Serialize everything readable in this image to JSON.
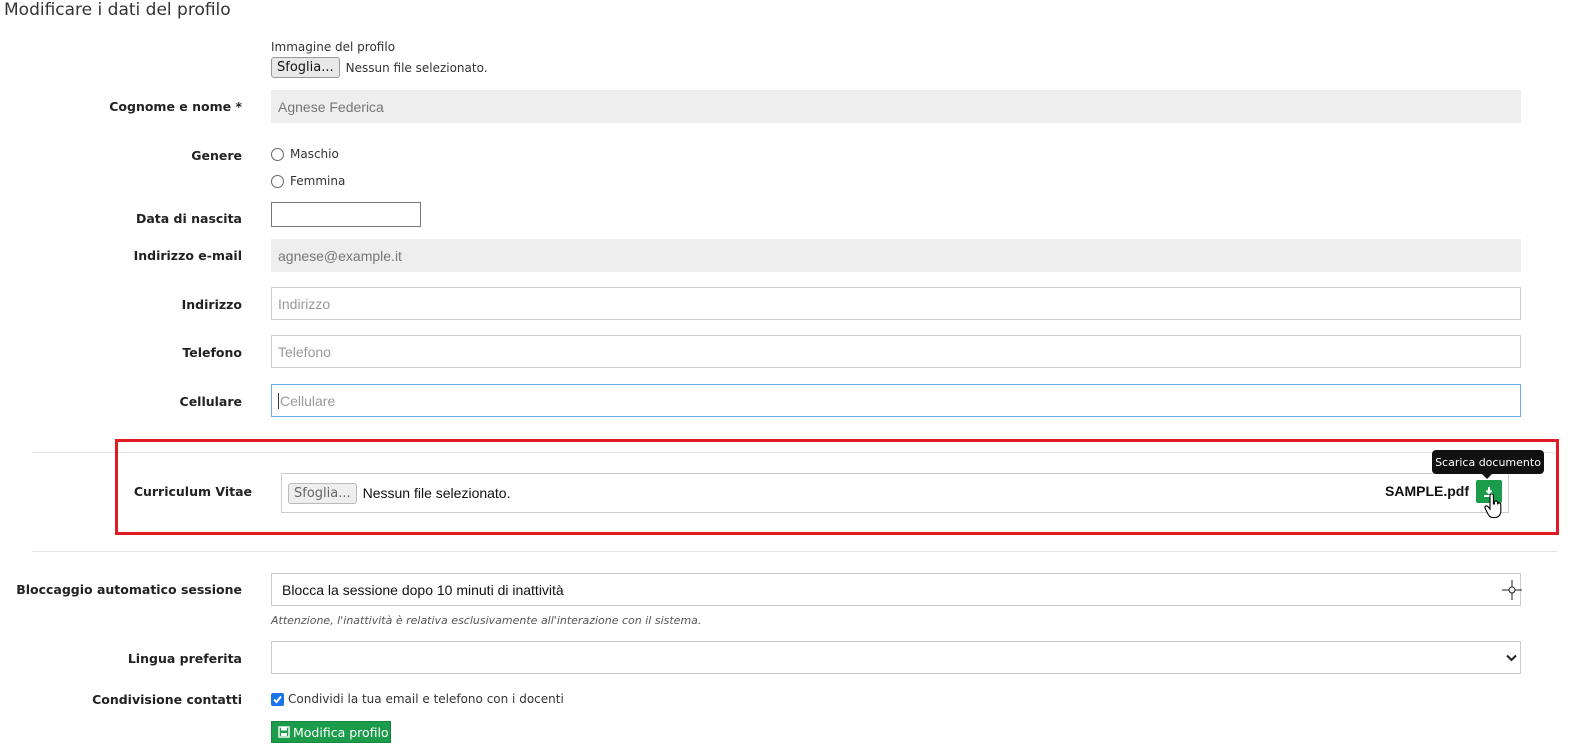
{
  "page_title": "Modificare i dati del profilo",
  "profile_image": {
    "label": "Immagine del profilo",
    "browse_label": "Sfoglia...",
    "status": "Nessun file selezionato."
  },
  "fields": {
    "name": {
      "label": "Cognome e nome *",
      "value": "Agnese Federica"
    },
    "gender": {
      "label": "Genere",
      "options": [
        "Maschio",
        "Femmina"
      ]
    },
    "birthdate": {
      "label": "Data di nascita",
      "value": ""
    },
    "email": {
      "label": "Indirizzo e-mail",
      "value": "agnese@example.it"
    },
    "address": {
      "label": "Indirizzo",
      "placeholder": "Indirizzo"
    },
    "phone": {
      "label": "Telefono",
      "placeholder": "Telefono"
    },
    "mobile": {
      "label": "Cellulare",
      "placeholder": "Cellulare"
    }
  },
  "cv": {
    "label": "Curriculum Vitae",
    "browse_label": "Sfoglia...",
    "status": "Nessun file selezionato.",
    "file_name": "SAMPLE.pdf",
    "tooltip": "Scarica documento"
  },
  "session_lock": {
    "label": "Bloccaggio automatico sessione",
    "value": "Blocca la sessione dopo 10 minuti di inattività",
    "help": "Attenzione, l'inattività è relativa esclusivamente all'interazione con il sistema."
  },
  "language": {
    "label": "Lingua preferita",
    "value": ""
  },
  "contacts": {
    "label": "Condivisione contatti",
    "checkbox_label": "Condividi la tua email e telefono con i docenti",
    "checked": true
  },
  "submit_label": "Modifica profilo",
  "colors": {
    "accent_green": "#1a9c4b",
    "highlight_red": "#e01b24"
  }
}
